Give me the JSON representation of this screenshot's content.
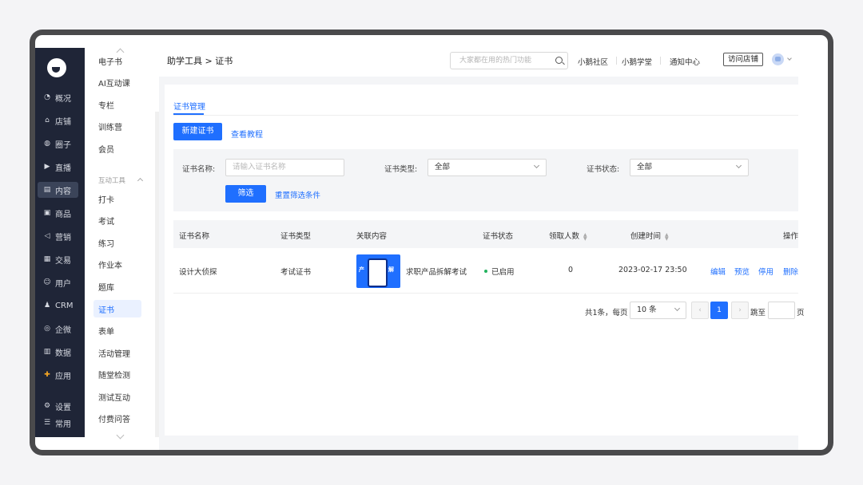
{
  "dark_nav": [
    {
      "icon": "◔",
      "label": "概况",
      "name": "overview"
    },
    {
      "icon": "⌂",
      "label": "店铺",
      "name": "shop"
    },
    {
      "icon": "◍",
      "label": "圈子",
      "name": "circle"
    },
    {
      "icon": "▶",
      "label": "直播",
      "name": "live"
    },
    {
      "icon": "▤",
      "label": "内容",
      "name": "content"
    },
    {
      "icon": "▣",
      "label": "商品",
      "name": "goods"
    },
    {
      "icon": "◁",
      "label": "营销",
      "name": "marketing"
    },
    {
      "icon": "▦",
      "label": "交易",
      "name": "trade"
    },
    {
      "icon": "☺",
      "label": "用户",
      "name": "user"
    },
    {
      "icon": "♟",
      "label": "CRM",
      "name": "crm"
    },
    {
      "icon": "◎",
      "label": "企微",
      "name": "wecom"
    },
    {
      "icon": "▥",
      "label": "数据",
      "name": "data"
    },
    {
      "icon": "✚",
      "label": "应用",
      "name": "apps"
    },
    {
      "icon": "⚙",
      "label": "设置",
      "name": "settings"
    },
    {
      "icon": "☰",
      "label": "常用",
      "name": "common"
    }
  ],
  "sub_nav": {
    "items_top": [
      "电子书",
      "AI互动课",
      "专栏",
      "训练营",
      "会员"
    ],
    "group_label": "互动工具",
    "items_bottom": [
      "打卡",
      "考试",
      "练习",
      "作业本",
      "题库",
      "证书",
      "表单",
      "活动管理",
      "随堂检测",
      "测试互动",
      "付费问答"
    ]
  },
  "header": {
    "breadcrumb": "助学工具 > 证书",
    "search_placeholder": "大家都在用的热门功能",
    "links": [
      "小鹅社区",
      "小鹅学堂",
      "通知中心"
    ],
    "visit_shop": "访问店铺"
  },
  "page": {
    "tab": "证书管理",
    "new_button": "新建证书",
    "tutorial_link": "查看教程"
  },
  "filters": {
    "name_label": "证书名称:",
    "name_placeholder": "请输入证书名称",
    "type_label": "证书类型:",
    "type_value": "全部",
    "status_label": "证书状态:",
    "status_value": "全部",
    "filter_button": "筛选",
    "reset_link": "重置筛选条件"
  },
  "table": {
    "headers": [
      "证书名称",
      "证书类型",
      "关联内容",
      "证书状态",
      "领取人数",
      "创建时间",
      "操作"
    ],
    "rows": [
      {
        "name": "设计大侦探",
        "type": "考试证书",
        "thumb_text_left": "产",
        "thumb_text_right": "解",
        "related": "求职产品拆解考试",
        "status": "已启用",
        "count": "0",
        "created": "2023-02-17 23:50",
        "actions": [
          "编辑",
          "预览",
          "停用",
          "删除"
        ]
      }
    ]
  },
  "pagination": {
    "total": "共1条，每页",
    "page_size": "10 条",
    "prev": "‹",
    "current": "1",
    "next": "›",
    "jump_label": "跳至",
    "page_suffix": "页"
  },
  "colors": {
    "primary": "#1f6fff",
    "sidebar": "#1f2537",
    "status_enabled": "#22b35e"
  }
}
